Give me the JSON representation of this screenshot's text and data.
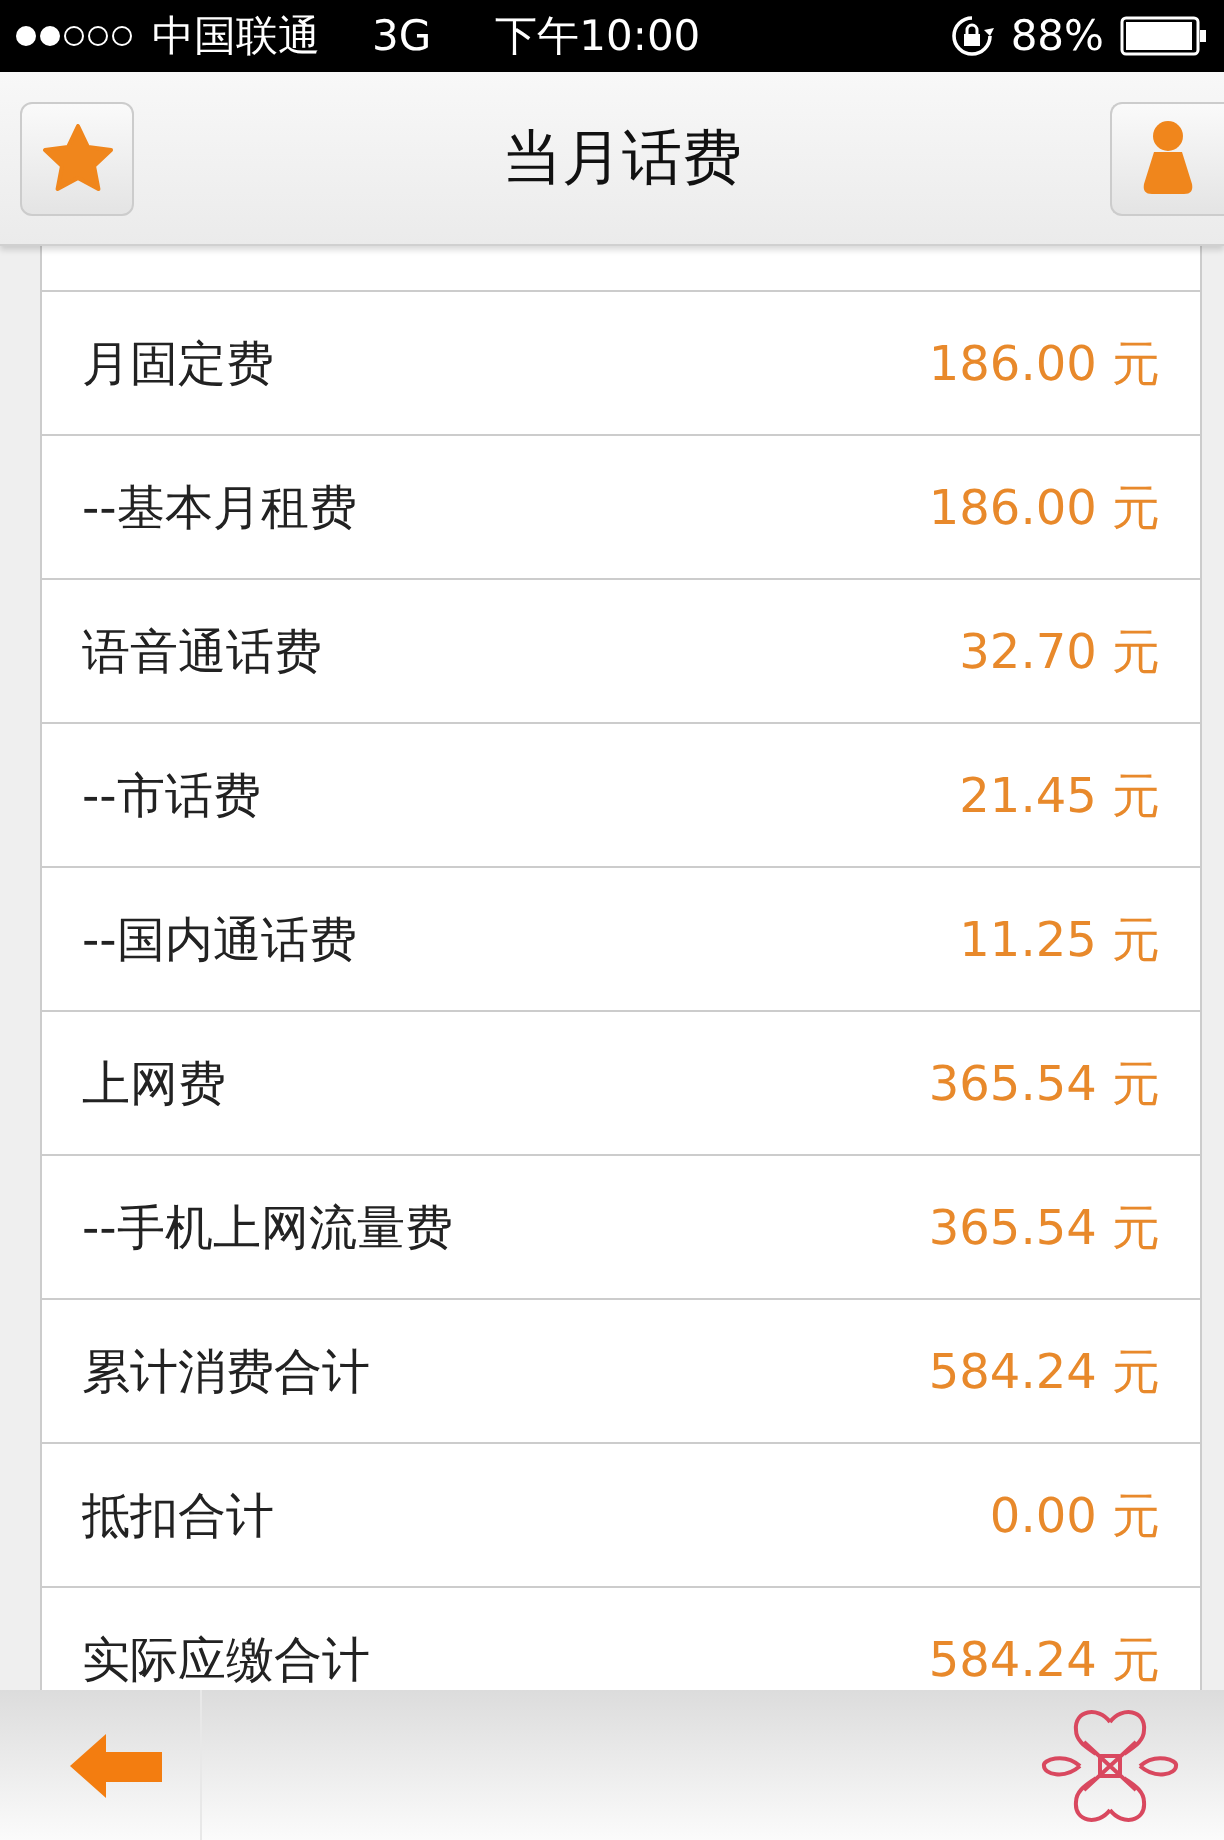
{
  "status_bar": {
    "carrier": "中国联通",
    "network": "3G",
    "time": "下午10:00",
    "battery": "88%"
  },
  "header": {
    "title": "当月话费"
  },
  "rows": [
    {
      "label": "月固定费",
      "value": "186.00 元"
    },
    {
      "label": "--基本月租费",
      "value": "186.00 元"
    },
    {
      "label": "语音通话费",
      "value": "32.70 元"
    },
    {
      "label": "--市话费",
      "value": "21.45 元"
    },
    {
      "label": "--国内通话费",
      "value": "11.25 元"
    },
    {
      "label": "上网费",
      "value": "365.54 元"
    },
    {
      "label": "--手机上网流量费",
      "value": "365.54 元"
    },
    {
      "label": "累计消费合计",
      "value": "584.24 元"
    },
    {
      "label": "抵扣合计",
      "value": "0.00 元"
    },
    {
      "label": "实际应缴合计",
      "value": "584.24 元"
    }
  ]
}
